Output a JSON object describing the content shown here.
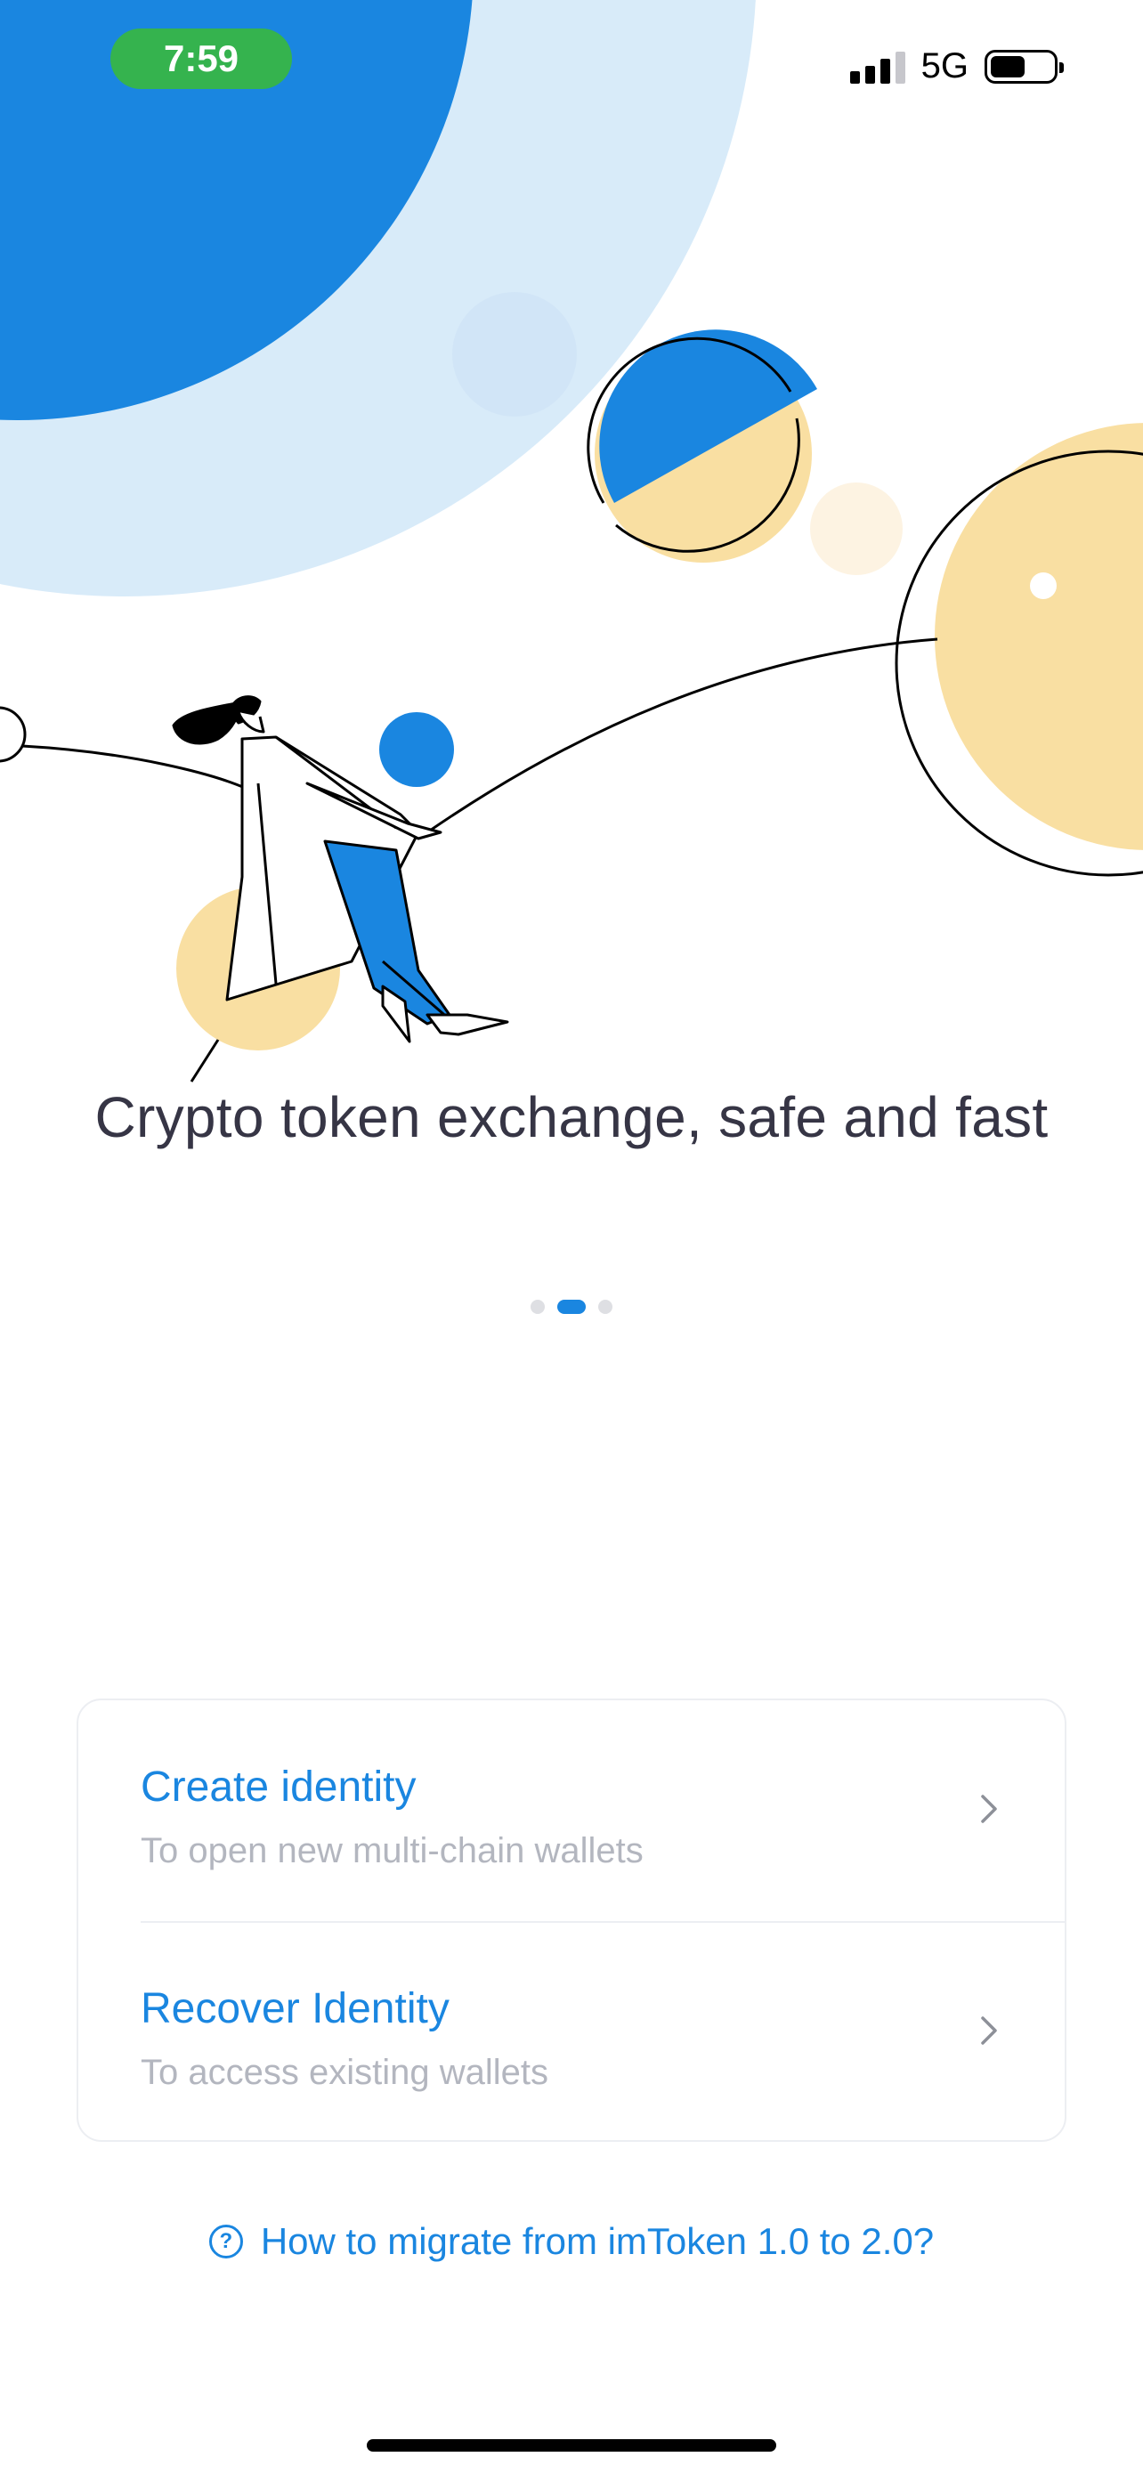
{
  "status_bar": {
    "time": "7:59",
    "network": "5G",
    "battery_level": 0.6,
    "signal_bars": 3
  },
  "onboarding": {
    "headline": "Crypto token exchange, safe and fast",
    "page_count": 3,
    "active_page": 2
  },
  "actions": [
    {
      "title": "Create identity",
      "subtitle": "To open new multi-chain wallets",
      "icon": "chevron-right-icon"
    },
    {
      "title": "Recover Identity",
      "subtitle": "To access existing wallets",
      "icon": "chevron-right-icon"
    }
  ],
  "help": {
    "icon": "question-circle-icon",
    "icon_glyph": "?",
    "label": "How to migrate from imToken 1.0 to 2.0?"
  },
  "colors": {
    "accent_blue": "#1a86e0",
    "light_blue": "#d8ebf9",
    "sand": "#f9dfa2",
    "status_green": "#35b34e",
    "headline_text": "#363545",
    "muted_text": "#b3b6bf"
  }
}
